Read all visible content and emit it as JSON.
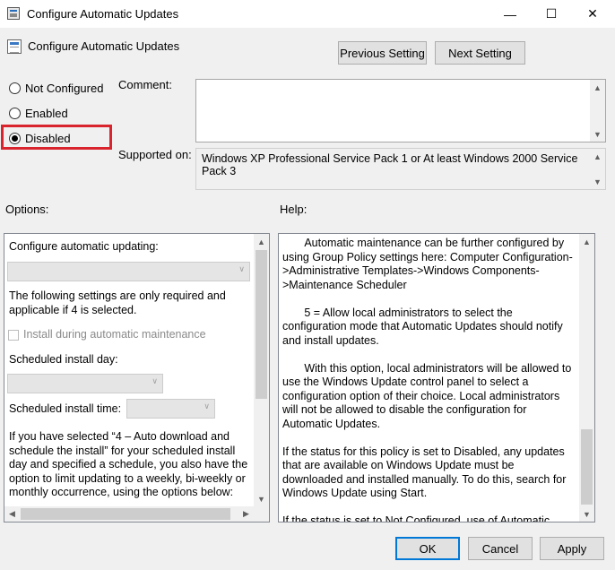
{
  "window": {
    "title": "Configure Automatic Updates",
    "controls": {
      "minimize": "—",
      "maximize": "☐",
      "close": "✕"
    }
  },
  "header": {
    "policy_name": "Configure Automatic Updates",
    "previous_button": "Previous Setting",
    "next_button": "Next Setting"
  },
  "state": {
    "options": [
      {
        "label": "Not Configured",
        "selected": false
      },
      {
        "label": "Enabled",
        "selected": false
      },
      {
        "label": "Disabled",
        "selected": true
      }
    ],
    "highlight_color": "#d9232d"
  },
  "comment": {
    "label": "Comment:",
    "value": ""
  },
  "supported": {
    "label": "Supported on:",
    "value": "Windows XP Professional Service Pack 1 or At least Windows 2000 Service Pack 3"
  },
  "options_pane": {
    "heading": "Options:",
    "configure_label": "Configure automatic updating:",
    "configure_value": "",
    "note": "The following settings are only required and applicable if 4 is selected.",
    "checkbox_label": "Install during automatic maintenance",
    "install_day_label": "Scheduled install day:",
    "install_day_value": "",
    "install_time_label": "Scheduled install time:",
    "install_time_value": "",
    "description": "If you have selected “4 – Auto download and schedule the install” for your scheduled install day and specified a schedule, you also have the option to limit updating to a weekly, bi-weekly or monthly occurrence, using the options below:"
  },
  "help_pane": {
    "heading": "Help:",
    "paragraphs": [
      "       Automatic maintenance can be further configured by using Group Policy settings here: Computer Configuration->Administrative Templates->Windows Components->Maintenance Scheduler",
      "       5 = Allow local administrators to select the configuration mode that Automatic Updates should notify and install updates.",
      "       With this option, local administrators will be allowed to use the Windows Update control panel to select a configuration option of their choice. Local administrators will not be allowed to disable the configuration for Automatic Updates.",
      "If the status for this policy is set to Disabled, any updates that are available on Windows Update must be downloaded and installed manually. To do this, search for Windows Update using Start.",
      "If the status is set to Not Configured, use of Automatic Updates is not specified at the Group Policy level. However, an administrator can still configure Automatic Updates through Control Panel."
    ]
  },
  "footer": {
    "ok": "OK",
    "cancel": "Cancel",
    "apply": "Apply"
  },
  "icons": {
    "scroll_up": "▲",
    "scroll_down": "▼",
    "scroll_left": "◀",
    "scroll_right": "▶",
    "dropdown": "∨"
  }
}
